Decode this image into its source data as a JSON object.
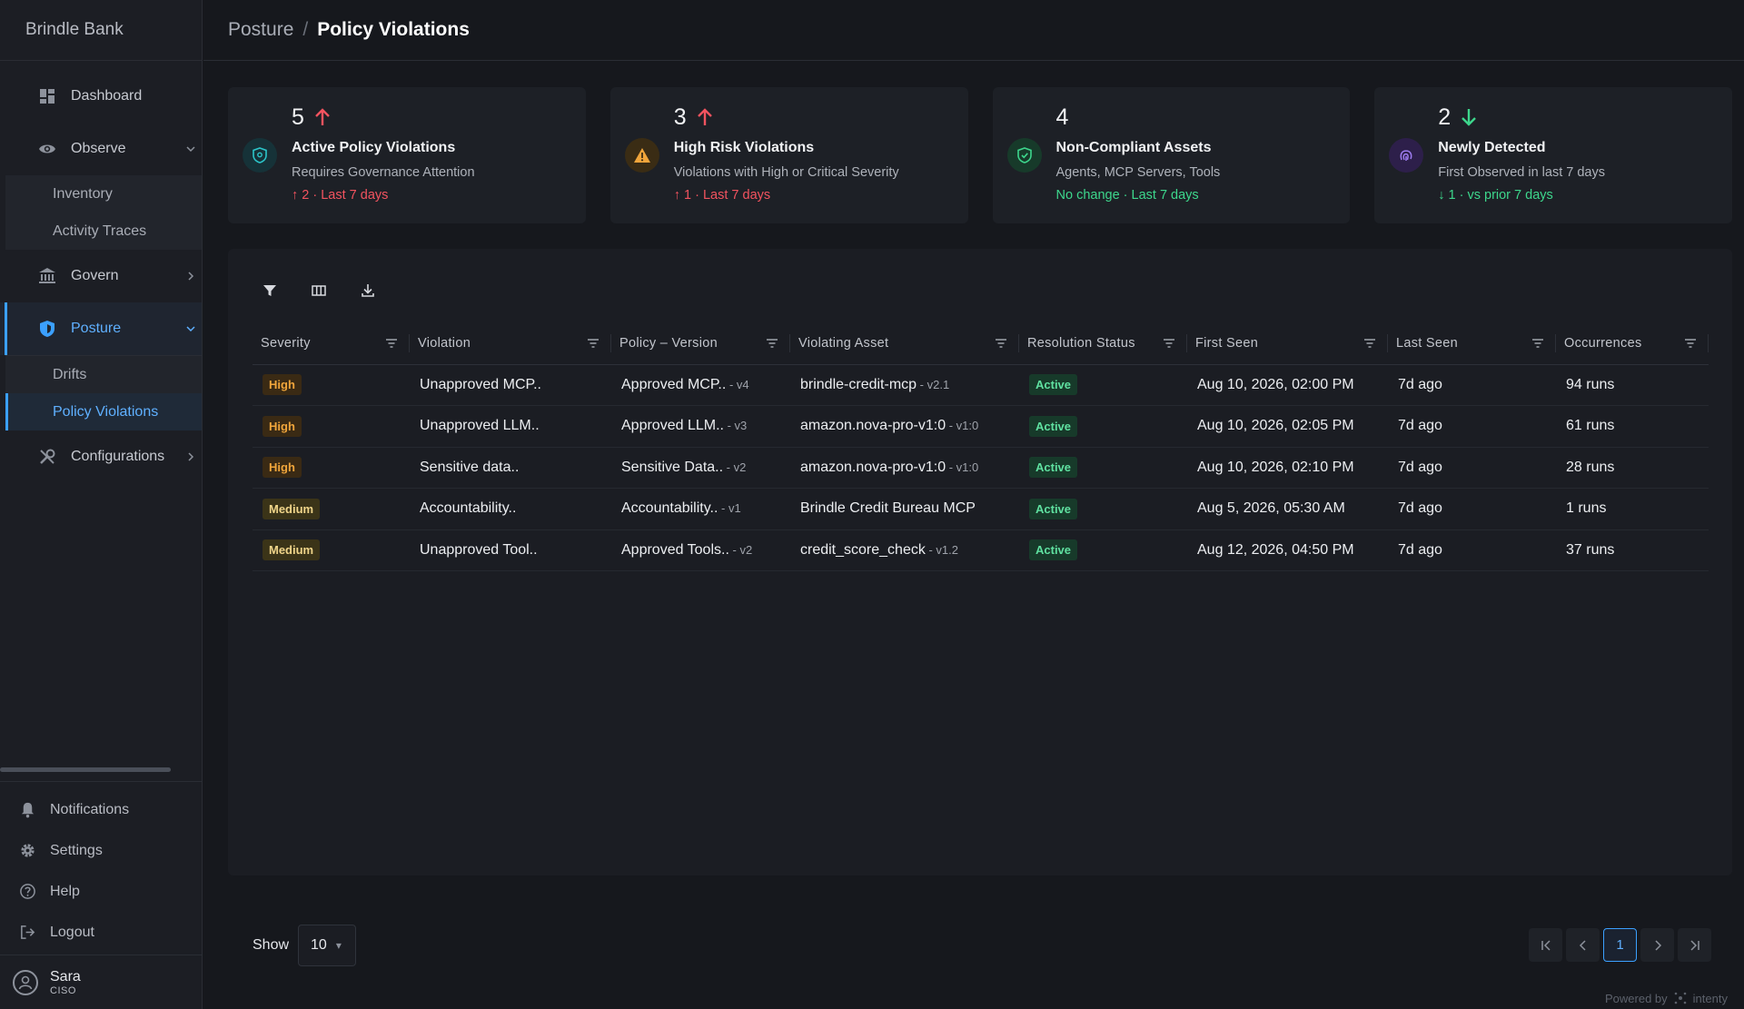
{
  "app": {
    "brand": "Brindle Bank"
  },
  "sidebar": {
    "items": [
      {
        "label": "Dashboard"
      },
      {
        "label": "Observe",
        "children": [
          {
            "label": "Inventory"
          },
          {
            "label": "Activity Traces"
          }
        ]
      },
      {
        "label": "Govern"
      },
      {
        "label": "Posture",
        "children": [
          {
            "label": "Drifts"
          },
          {
            "label": "Policy Violations"
          }
        ]
      },
      {
        "label": "Configurations"
      }
    ],
    "bottom": [
      {
        "label": "Notifications"
      },
      {
        "label": "Settings"
      },
      {
        "label": "Help"
      },
      {
        "label": "Logout"
      }
    ],
    "user": {
      "name": "Sara",
      "role": "CISO"
    }
  },
  "header": {
    "parent": "Posture",
    "separator": "/",
    "current": "Policy Violations"
  },
  "cards": [
    {
      "value": "5",
      "title": "Active Policy Violations",
      "subtitle": "Requires Governance Attention",
      "trend": "↑ 2 · Last 7 days",
      "trend_color": "#f2535f",
      "icon": "shield-icon"
    },
    {
      "value": "3",
      "title": "High Risk Violations",
      "subtitle": "Violations with High or Critical Severity",
      "trend": "↑ 1 · Last 7 days",
      "trend_color": "#f2535f",
      "icon": "warning-icon"
    },
    {
      "value": "4",
      "title": "Non-Compliant Assets",
      "subtitle": "Agents, MCP Servers, Tools",
      "trend": "No change · Last 7 days",
      "trend_color": "#3dd68c",
      "icon": "shield-check-icon"
    },
    {
      "value": "2",
      "title": "Newly Detected",
      "subtitle": "First Observed in last 7 days",
      "trend": "↓ 1 · vs prior 7 days",
      "trend_color": "#3dd68c",
      "icon": "fingerprint-icon"
    }
  ],
  "table": {
    "columns": [
      "Severity",
      "Violation",
      "Policy – Version",
      "Violating Asset",
      "Resolution Status",
      "First Seen",
      "Last Seen",
      "Occurrences"
    ],
    "rows": [
      {
        "severity": "High",
        "violation": "Unapproved MCP..",
        "policy": "Approved MCP..",
        "policy_ver": " - v4",
        "asset": "brindle-credit-mcp",
        "asset_ver": " - v2.1",
        "status": "Active",
        "first_seen": "Aug 10, 2026, 02:00 PM",
        "last_seen": "7d ago",
        "occurrences": "94 runs"
      },
      {
        "severity": "High",
        "violation": "Unapproved LLM..",
        "policy": "Approved LLM..",
        "policy_ver": " - v3",
        "asset": "amazon.nova-pro-v1:0",
        "asset_ver": " - v1:0",
        "status": "Active",
        "first_seen": "Aug 10, 2026, 02:05 PM",
        "last_seen": "7d ago",
        "occurrences": "61 runs"
      },
      {
        "severity": "High",
        "violation": "Sensitive data..",
        "policy": "Sensitive Data..",
        "policy_ver": " - v2",
        "asset": "amazon.nova-pro-v1:0",
        "asset_ver": " - v1:0",
        "status": "Active",
        "first_seen": "Aug 10, 2026, 02:10 PM",
        "last_seen": "7d ago",
        "occurrences": "28 runs"
      },
      {
        "severity": "Medium",
        "violation": "Accountability..",
        "policy": "Accountability..",
        "policy_ver": " - v1",
        "asset": "Brindle Credit Bureau MCP",
        "asset_ver": "",
        "status": "Active",
        "first_seen": "Aug 5, 2026, 05:30 AM",
        "last_seen": "7d ago",
        "occurrences": "1 runs"
      },
      {
        "severity": "Medium",
        "violation": "Unapproved Tool..",
        "policy": "Approved Tools..",
        "policy_ver": " - v2",
        "asset": "credit_score_check",
        "asset_ver": " - v1.2",
        "status": "Active",
        "first_seen": "Aug 12, 2026, 04:50 PM",
        "last_seen": "7d ago",
        "occurrences": "37 runs"
      }
    ]
  },
  "pagination": {
    "show_label": "Show",
    "page_size": "10",
    "current_page": "1"
  },
  "footer": {
    "powered_by": "Powered by",
    "vendor": "intenty"
  },
  "colors": {
    "accent": "#3ba0ff",
    "danger": "#f2535f",
    "success": "#3dd68c",
    "warning": "#f0a53b"
  }
}
